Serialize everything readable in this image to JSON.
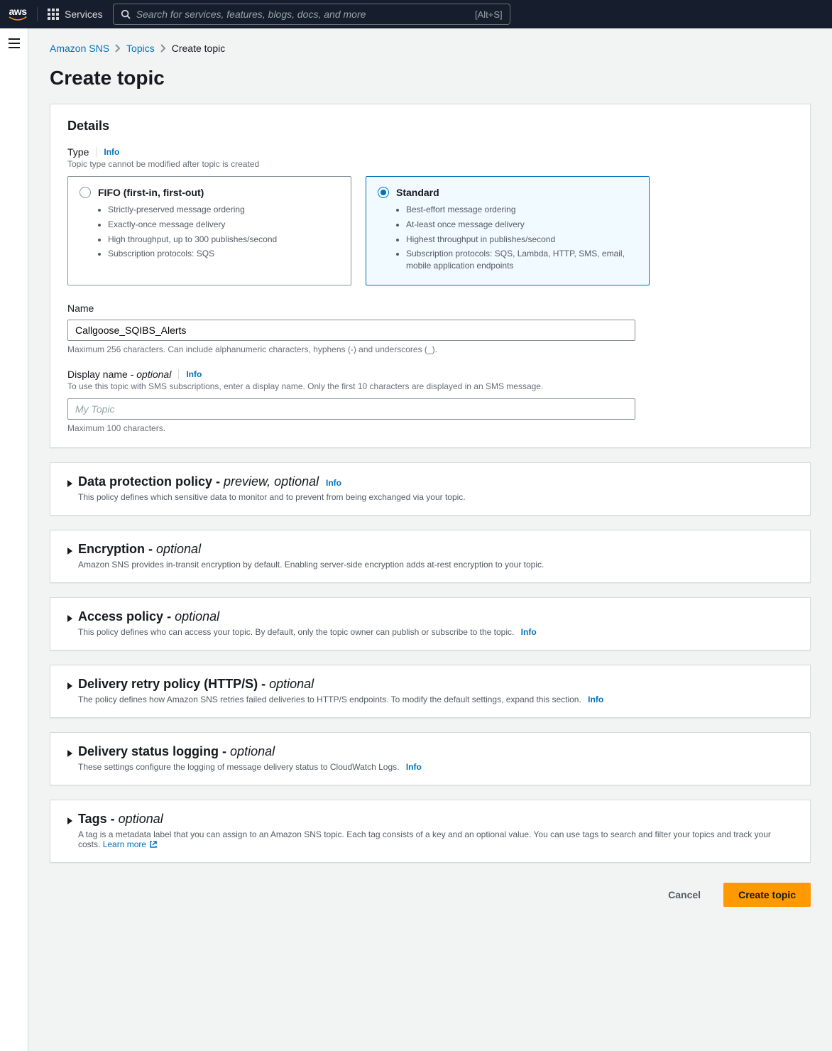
{
  "topnav": {
    "services_label": "Services",
    "search_placeholder": "Search for services, features, blogs, docs, and more",
    "search_shortcut": "[Alt+S]"
  },
  "breadcrumbs": {
    "root": "Amazon SNS",
    "topics": "Topics",
    "current": "Create topic"
  },
  "page_title": "Create topic",
  "details": {
    "panel_title": "Details",
    "type_label": "Type",
    "type_info": "Info",
    "type_help": "Topic type cannot be modified after topic is created",
    "fifo": {
      "title": "FIFO (first-in, first-out)",
      "b1": "Strictly-preserved message ordering",
      "b2": "Exactly-once message delivery",
      "b3": "High throughput, up to 300 publishes/second",
      "b4": "Subscription protocols: SQS"
    },
    "standard": {
      "title": "Standard",
      "b1": "Best-effort message ordering",
      "b2": "At-least once message delivery",
      "b3": "Highest throughput in publishes/second",
      "b4": "Subscription protocols: SQS, Lambda, HTTP, SMS, email, mobile application endpoints"
    },
    "name_label": "Name",
    "name_value": "Callgoose_SQIBS_Alerts",
    "name_help": "Maximum 256 characters. Can include alphanumeric characters, hyphens (-) and underscores (_).",
    "display_label": "Display name - ",
    "display_optional": "optional",
    "display_info": "Info",
    "display_help": "To use this topic with SMS subscriptions, enter a display name. Only the first 10 characters are displayed in an SMS message.",
    "display_placeholder": "My Topic",
    "display_below": "Maximum 100 characters."
  },
  "sections": {
    "dpp": {
      "title": "Data protection policy - ",
      "suffix": "preview, optional",
      "info": "Info",
      "desc": "This policy defines which sensitive data to monitor and to prevent from being exchanged via your topic."
    },
    "enc": {
      "title": "Encryption - ",
      "suffix": "optional",
      "desc": "Amazon SNS provides in-transit encryption by default. Enabling server-side encryption adds at-rest encryption to your topic."
    },
    "acc": {
      "title": "Access policy - ",
      "suffix": "optional",
      "desc": "This policy defines who can access your topic. By default, only the topic owner can publish or subscribe to the topic.",
      "info": "Info"
    },
    "retry": {
      "title": "Delivery retry policy (HTTP/S) - ",
      "suffix": "optional",
      "desc": "The policy defines how Amazon SNS retries failed deliveries to HTTP/S endpoints. To modify the default settings, expand this section.",
      "info": "Info"
    },
    "log": {
      "title": "Delivery status logging - ",
      "suffix": "optional",
      "desc": "These settings configure the logging of message delivery status to CloudWatch Logs.",
      "info": "Info"
    },
    "tags": {
      "title": "Tags - ",
      "suffix": "optional",
      "desc": "A tag is a metadata label that you can assign to an Amazon SNS topic. Each tag consists of a key and an optional value. You can use tags to search and filter your topics and track your costs.",
      "learn": "Learn more"
    }
  },
  "footer": {
    "cancel": "Cancel",
    "create": "Create topic"
  }
}
